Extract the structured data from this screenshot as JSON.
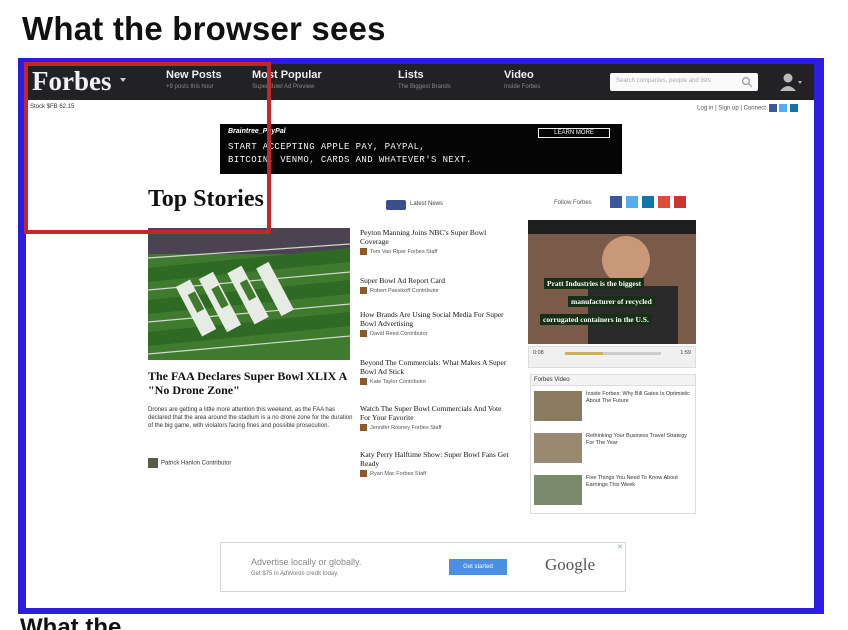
{
  "slide": {
    "title": "What the browser sees",
    "bottom_text": "What the"
  },
  "colors": {
    "frame": "#2d1de0",
    "highlight": "#c0282c",
    "nav_bg": "#222225"
  },
  "header": {
    "logo": "Forbes",
    "nav": [
      {
        "label": "New Posts",
        "sub": "+9 posts this hour"
      },
      {
        "label": "Most Popular",
        "sub": "Super Bowl Ad Preview"
      },
      {
        "label": "Lists",
        "sub": "The Biggest Brands"
      },
      {
        "label": "Video",
        "sub": "Inside Forbes"
      }
    ],
    "search_placeholder": "Search companies, people and lists",
    "icons": [
      "search-icon",
      "user-icon"
    ]
  },
  "subbar": {
    "stock": "Stock $FB 62.15",
    "links": "Log in | Sign up | Connect"
  },
  "top_ad": {
    "brand": "Braintree_PayPal",
    "line1": "START ACCEPTING APPLE PAY, PAYPAL,",
    "line2": "BITCOIN, VENMO, CARDS AND WHATEVER'S NEXT.",
    "cta": "LEARN MORE"
  },
  "top_stories": {
    "title": "Top Stories",
    "latest": "Latest News",
    "follow": "Follow Forbes",
    "hero_headline": "The FAA Declares Super Bowl XLIX A \"No Drone Zone\"",
    "hero_blurb": "Drones are getting a little more attention this weekend, as the FAA has declared that the area around the stadium is a no drone zone for the duration of the big game, with violators facing fines and possible prosecution.",
    "hero_author": "Patrick Hanlon Contributor",
    "stories": [
      {
        "headline": "Peyton Manning Joins NBC's Super Bowl Coverage",
        "author": "Tom Van Riper Forbes Staff"
      },
      {
        "headline": "Super Bowl Ad Report Card",
        "author": "Robert Passikoff Contributor"
      },
      {
        "headline": "How Brands Are Using Social Media For Super Bowl Advertising",
        "author": "David Reed Contributor"
      },
      {
        "headline": "Beyond The Commercials: What Makes A Super Bowl Ad Stick",
        "author": "Kate Taylor Contributor"
      },
      {
        "headline": "Watch The Super Bowl Commercials And Vote For Your Favorite",
        "author": "Jennifer Rooney Forbes Staff"
      },
      {
        "headline": "Katy Perry Halftime Show: Super Bowl Fans Get Ready",
        "author": "Ryan Mac Forbes Staff"
      }
    ]
  },
  "video": {
    "line1": "Pratt Industries is the biggest",
    "line2": "manufacturer of recycled",
    "line3": "corrugated containers in the U.S.",
    "time_left": "0:08",
    "time_right": "1:59"
  },
  "related": {
    "header": "Forbes Video",
    "items": [
      {
        "text": "Inside Forbes: Why Bill Gates Is Optimistic About The Future"
      },
      {
        "text": "Rethinking Your Business Travel Strategy For The Year"
      },
      {
        "text": "Five Things You Need To Know About Earnings This Week"
      }
    ]
  },
  "bottom_ad": {
    "line1": "Advertise locally or globally.",
    "line2": "Get $75 in AdWords credit today.",
    "cta": "Get started",
    "brand": "Google"
  }
}
